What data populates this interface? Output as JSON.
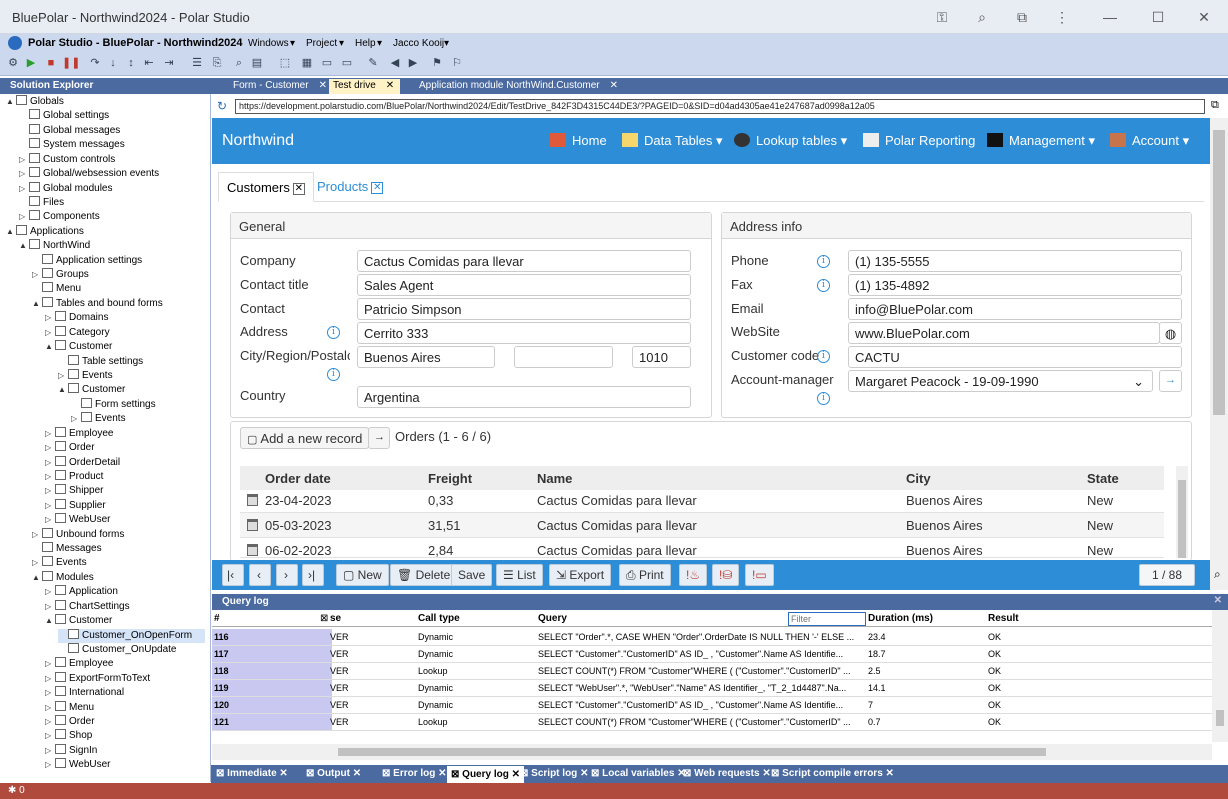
{
  "window": {
    "title": "BluePolar - Northwind2024 - Polar Studio"
  },
  "menubar": {
    "app_title": "Polar Studio - BluePolar - Northwind2024",
    "menus": [
      "Windows",
      "Project",
      "Help",
      "Jacco Kooij"
    ]
  },
  "explorer": {
    "title": "Solution Explorer",
    "items": [
      {
        "label": "Globals"
      },
      {
        "label": "Global settings"
      },
      {
        "label": "Global messages"
      },
      {
        "label": "System messages"
      },
      {
        "label": "Custom controls"
      },
      {
        "label": "Global/websession events"
      },
      {
        "label": "Global modules"
      },
      {
        "label": "Files"
      },
      {
        "label": "Components"
      },
      {
        "label": "Applications"
      },
      {
        "label": "NorthWind"
      },
      {
        "label": "Application settings"
      },
      {
        "label": "Groups"
      },
      {
        "label": "Menu"
      },
      {
        "label": "Tables and bound forms"
      },
      {
        "label": "Domains"
      },
      {
        "label": "Category"
      },
      {
        "label": "Customer"
      },
      {
        "label": "Table settings"
      },
      {
        "label": "Events"
      },
      {
        "label": "Customer"
      },
      {
        "label": "Form settings"
      },
      {
        "label": "Events"
      },
      {
        "label": "Employee"
      },
      {
        "label": "Order"
      },
      {
        "label": "OrderDetail"
      },
      {
        "label": "Product"
      },
      {
        "label": "Shipper"
      },
      {
        "label": "Supplier"
      },
      {
        "label": "WebUser"
      },
      {
        "label": "Unbound forms"
      },
      {
        "label": "Messages"
      },
      {
        "label": "Events"
      },
      {
        "label": "Modules"
      },
      {
        "label": "Application"
      },
      {
        "label": "ChartSettings"
      },
      {
        "label": "Customer"
      },
      {
        "label": "Customer_OnOpenForm"
      },
      {
        "label": "Customer_OnUpdate"
      },
      {
        "label": "Employee"
      },
      {
        "label": "ExportFormToText"
      },
      {
        "label": "International"
      },
      {
        "label": "Menu"
      },
      {
        "label": "Order"
      },
      {
        "label": "Shop"
      },
      {
        "label": "SignIn"
      },
      {
        "label": "WebUser"
      }
    ]
  },
  "doc_tabs": [
    "Form - Customer",
    "Test drive",
    "Application module NorthWind.Customer"
  ],
  "url": "https://development.polarstudio.com/BluePolar/Northwind2024/Edit/TestDrive_842F3D4315C44DE3/?PAGEID=0&SID=d04ad4305ae41e247687ad0998a12a05",
  "appnav": {
    "brand": "Northwind",
    "items": [
      "Home",
      "Data Tables",
      "Lookup tables",
      "Polar Reporting",
      "Management",
      "Account"
    ]
  },
  "tabs": [
    "Customers",
    "Products"
  ],
  "general": {
    "title": "General",
    "company_label": "Company",
    "company": "Cactus Comidas para llevar",
    "contact_title_label": "Contact title",
    "contact_title": "Sales Agent",
    "contact_label": "Contact",
    "contact": "Patricio Simpson",
    "address_label": "Address",
    "address": "Cerrito 333",
    "city_label": "City/Region/Postalc",
    "city": "Buenos Aires",
    "region": "",
    "postal": "1010",
    "country_label": "Country",
    "country": "Argentina"
  },
  "address": {
    "title": "Address info",
    "phone_label": "Phone",
    "phone": "(1) 135-5555",
    "fax_label": "Fax",
    "fax": "(1) 135-4892",
    "email_label": "Email",
    "email": "info@BluePolar.com",
    "website_label": "WebSite",
    "website": "www.BluePolar.com",
    "code_label": "Customer code",
    "code": "CACTU",
    "manager_label": "Account-manager",
    "manager": "Margaret Peacock - 19-09-1990"
  },
  "orders": {
    "add_label": "Add a new record",
    "title": "Orders (1 - 6 / 6)",
    "columns": [
      "Order date",
      "Freight",
      "Name",
      "City",
      "State"
    ],
    "rows": [
      [
        "23-04-2023",
        "0,33",
        "Cactus Comidas para llevar",
        "Buenos Aires",
        "New"
      ],
      [
        "05-03-2023",
        "31,51",
        "Cactus Comidas para llevar",
        "Buenos Aires",
        "New"
      ],
      [
        "06-02-2023",
        "2,84",
        "Cactus Comidas para llevar",
        "Buenos Aires",
        "New"
      ]
    ]
  },
  "appbar": {
    "new": "New",
    "delete": "Delete",
    "save": "Save",
    "list": "List",
    "export": "Export",
    "print": "Print",
    "pager": "1 / 88"
  },
  "querylog": {
    "title": "Query log",
    "columns": [
      "#",
      "se",
      "Call type",
      "Query",
      "Duration (ms)",
      "Result"
    ],
    "filter_placeholder": "Filter",
    "rows": [
      {
        "num": "116",
        "se": "VER",
        "type": "Dynamic",
        "query": "SELECT \"Order\".*, CASE WHEN \"Order\".OrderDate IS NULL THEN '-' ELSE ...",
        "dur": "23.4",
        "res": "OK"
      },
      {
        "num": "117",
        "se": "VER",
        "type": "Dynamic",
        "query": "SELECT \"Customer\".\"CustomerID\" AS ID_ , \"Customer\".Name AS Identifie...",
        "dur": "18.7",
        "res": "OK"
      },
      {
        "num": "118",
        "se": "VER",
        "type": "Lookup",
        "query": "SELECT COUNT(*) FROM \"Customer\"WHERE ( (\"Customer\".\"CustomerID\" ...",
        "dur": "2.5",
        "res": "OK"
      },
      {
        "num": "119",
        "se": "VER",
        "type": "Dynamic",
        "query": "SELECT \"WebUser\".*, \"WebUser\".\"Name\" AS Identifier_, \"T_2_1d4487\".Na...",
        "dur": "14.1",
        "res": "OK"
      },
      {
        "num": "120",
        "se": "VER",
        "type": "Dynamic",
        "query": "SELECT \"Customer\".\"CustomerID\" AS ID_ , \"Customer\".Name AS Identifie...",
        "dur": "7",
        "res": "OK"
      },
      {
        "num": "121",
        "se": "VER",
        "type": "Lookup",
        "query": "SELECT COUNT(*) FROM \"Customer\"WHERE ( (\"Customer\".\"CustomerID\" ...",
        "dur": "0.7",
        "res": "OK"
      }
    ]
  },
  "bottom_tabs": [
    "Immediate",
    "Output",
    "Error log",
    "Query log",
    "Script log",
    "Local variables",
    "Web requests",
    "Script compile errors"
  ],
  "status": {
    "count": "0"
  },
  "colors": {
    "accent": "#2d8dd6",
    "panel_header": "#4a6aa0",
    "status": "#b04a3d"
  }
}
